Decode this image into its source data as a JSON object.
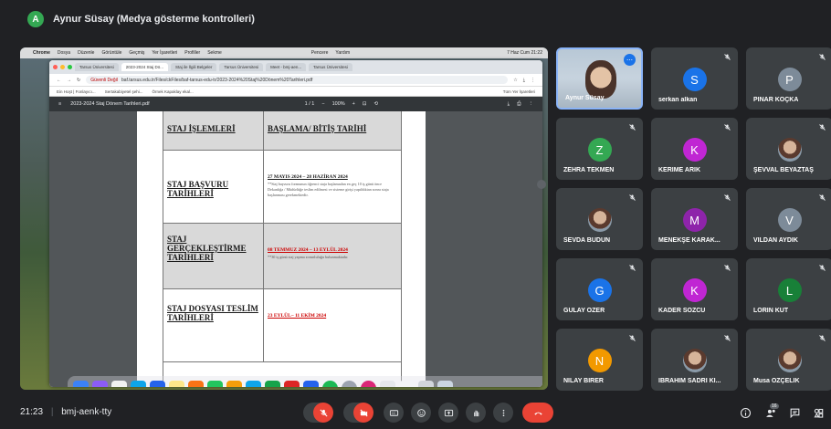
{
  "presenter": {
    "initial": "A",
    "label": "Aynur Süsay (Medya gösterme kontrolleri)"
  },
  "shared_screen": {
    "mac_menu": [
      "Chrome",
      "Dosya",
      "Düzenle",
      "Görüntüle",
      "Geçmiş",
      "Yer İşaretleri",
      "Profiller",
      "Sekme",
      "Pencere",
      "Yardım"
    ],
    "mac_clock": "7 Haz Cum 21:22",
    "tabs": [
      "Tarsus Üniversitesi",
      "2023-2024 Staj Dö...",
      "Staj ile İlgili Belgeler",
      "Tarsus Üniversitesi",
      "Meet - bmj-aen...",
      "Tarsus Üniversitesi"
    ],
    "address_security": "Güvenli Değil",
    "address_url": "baf.tarsus.edu.tr/Files/ckFiles/baf-tarsus-edu-tr/2023-2024%20Staj%20Dönem%20Tarihleri.pdf",
    "bookmarks": [
      "Ein Hoşt | Fonlayıcı...",
      "Sertakabiyetel şehi...",
      "Örnek Kapaklay ekal..."
    ],
    "bookmarks_right": "Tüm Yer İşaretleri",
    "pdf_title": "2023-2024 Staj Dönem Tarihleri.pdf",
    "pdf_page": "1 / 1",
    "pdf_zoom": "100%",
    "table": {
      "head_left": "STAJ İŞLEMLERİ",
      "head_right": "BAŞLAMA/ BİTİŞ TARİHİ",
      "rows": [
        {
          "label": "STAJ BAŞVURU TARİHLERİ",
          "date": "27 MAYIS 2024 – 28 HAZİRAN 2024",
          "note": "**Staj başvuru formunun öğrenci staja başlamadan en geç 10 iş günü önce Dekanlığa / Müdürlüğe teslim edilmesi ve sisteme girişi yapıldıktan sonra staja başlanması gerekmektedir."
        },
        {
          "label": "STAJ GERÇEKLEŞTİRME TARİHLERİ",
          "date": "08 TEMMUZ 2024 – 13 EYLÜL 2024",
          "note": "**30 iş günü staj yapma zorunluluğu bulunmaktadır."
        },
        {
          "label": "STAJ DOSYASI TESLİM TARİHLERİ",
          "date": "23 EYLÜL– 11 EKİM 2024",
          "note": ""
        }
      ]
    }
  },
  "participants": [
    {
      "name": "Aynur Süsay",
      "type": "self",
      "color": "#9fb3c8"
    },
    {
      "name": "serkan alkan",
      "initial": "S",
      "color": "#1a73e8"
    },
    {
      "name": "PINAR KOÇKA",
      "initial": "P",
      "color": "#7d8b99"
    },
    {
      "name": "ZEHRA TEKMEN",
      "initial": "Z",
      "color": "#34a853"
    },
    {
      "name": "KERİME ARIK",
      "initial": "K",
      "color": "#c026d3"
    },
    {
      "name": "ŞEVVAL BEYAZTAŞ",
      "type": "photo"
    },
    {
      "name": "SEVDA BÜDÜN",
      "type": "photo"
    },
    {
      "name": "MENEKŞE KARAK...",
      "initial": "M",
      "color": "#8e24aa"
    },
    {
      "name": "VİLDAN AYDIK",
      "initial": "V",
      "color": "#7d8b99"
    },
    {
      "name": "GÜLAY ÖZER",
      "initial": "G",
      "color": "#1a73e8"
    },
    {
      "name": "KADER SÖZCÜ",
      "initial": "K",
      "color": "#c026d3"
    },
    {
      "name": "LORİN KUT",
      "initial": "L",
      "color": "#188038"
    },
    {
      "name": "NİLAY BİRER",
      "initial": "N",
      "color": "#f29900"
    },
    {
      "name": "İBRAHİM SADRİ Kİ...",
      "type": "photo"
    },
    {
      "name": "Musa ÖZÇELİK",
      "type": "photo"
    }
  ],
  "bottom": {
    "time": "21:23",
    "separator": "|",
    "meeting_code": "bmj-aenk-tty",
    "people_count": "16"
  }
}
